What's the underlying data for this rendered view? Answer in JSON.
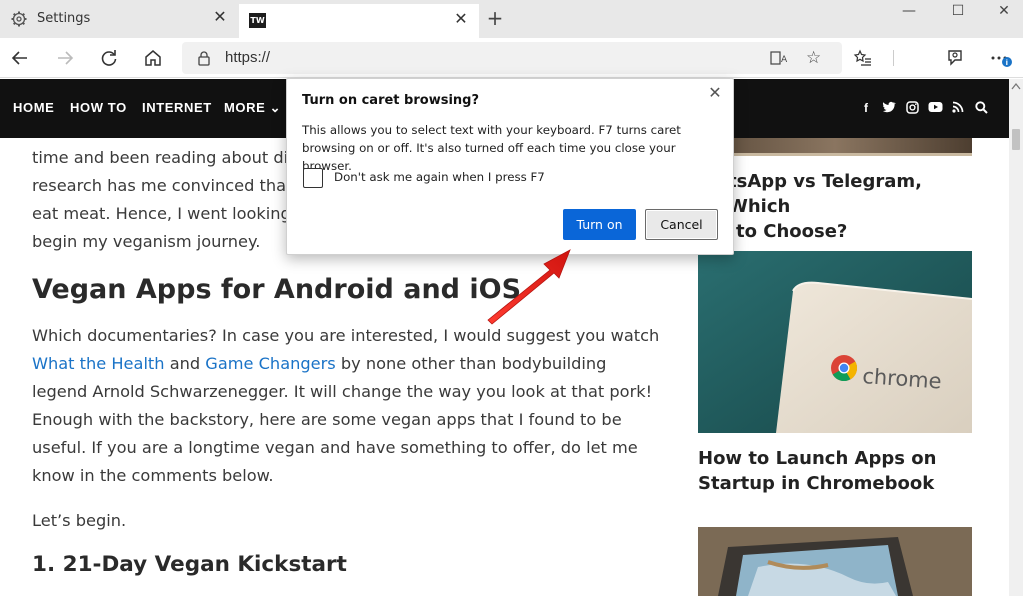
{
  "tabs": [
    {
      "label": "Settings",
      "icon": "gear-icon",
      "active": false
    },
    {
      "label": "",
      "icon": "tw-logo-icon",
      "logo_text": "TW",
      "active": true
    }
  ],
  "toolbar": {
    "url": "https://"
  },
  "site_nav": {
    "items": [
      "HOME",
      "HOW TO",
      "INTERNET",
      "MORE ⌄"
    ],
    "socials": [
      "facebook-icon",
      "twitter-icon",
      "instagram-icon",
      "youtube-icon",
      "rss-icon",
      "search-icon"
    ]
  },
  "article": {
    "intro_lines": [
      "time and been reading about diet",
      "research has me convinced that th",
      "eat meat. Hence, I went looking fo",
      "begin my veganism journey."
    ],
    "heading": "Vegan Apps for Android and iOS",
    "para1_before": "Which documentaries? In case you are interested, I would suggest you watch ",
    "link1": "What the Health",
    "para1_and": " and ",
    "link2": "Game Changers",
    "para1_after": " by none other than bodybuilding legend Arnold Schwarzenegger. It will change the way you look at that pork! Enough with the backstory, here are some vegan apps that I found to be useful. If you are a longtime vegan and have something to offer, do let me know in the comments below.",
    "para2": "Let’s begin.",
    "subheading": "1. 21-Day Vegan Kickstart"
  },
  "sidebar": {
    "title1_line1": "tsApp vs Telegram, Which",
    "title1_line2": "to Choose?",
    "chrome_word": "chrome",
    "title2_line1": "How to Launch Apps on",
    "title2_line2": "Startup in Chromebook"
  },
  "dialog": {
    "title": "Turn on caret browsing?",
    "body_line1": "This allows you to select text with your keyboard. F7 turns caret",
    "body_line2": "browsing on or off. It's also turned off each time you close your browser.",
    "checkbox_label": "Don't ask me again when I press F7",
    "checkbox_checked": false,
    "primary_label": "Turn on",
    "secondary_label": "Cancel"
  },
  "colors": {
    "accent": "#0a66d8",
    "link": "#1a73c7",
    "nav_bg": "#111111",
    "arrow": "#e3201b"
  }
}
